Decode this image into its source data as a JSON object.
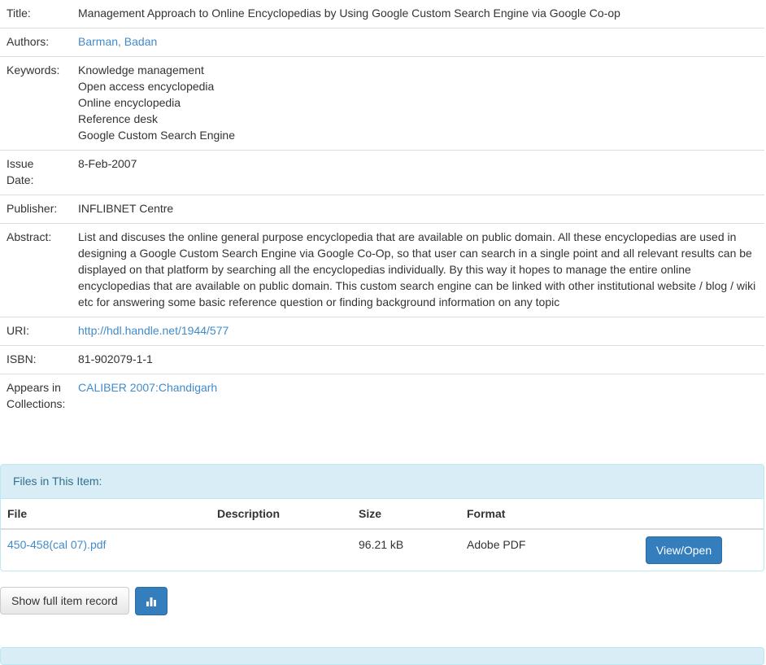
{
  "item": {
    "title_label": "Title:",
    "title": "Management Approach to Online Encyclopedias by Using Google Custom Search Engine via Google Co-op",
    "authors_label": "Authors:",
    "author": "Barman, Badan",
    "keywords_label": "Keywords:",
    "keywords": [
      "Knowledge management",
      "Open access encyclopedia",
      "Online encyclopedia",
      "Reference desk",
      "Google Custom Search Engine"
    ],
    "issue_date_label_1": "Issue",
    "issue_date_label_2": "Date:",
    "issue_date": "8-Feb-2007",
    "publisher_label": "Publisher:",
    "publisher": "INFLIBNET Centre",
    "abstract_label": "Abstract:",
    "abstract": "List and discuses the online general purpose encyclopedia that are available on public domain. All these encyclopedias are used in designing a Google Custom Search Engine via Google Co-Op, so that user can search in a single point and all relevant results can be displayed on that platform by searching all the encyclopedias individually. By this way it hopes to manage the entire online encyclopedias that are available on public domain. This custom search engine can be linked with other institutional website / blog / wiki etc for answering some basic reference question or finding background information on any topic",
    "uri_label": "URI:",
    "uri": "http://hdl.handle.net/1944/577",
    "isbn_label": "ISBN:",
    "isbn": "81-902079-1-1",
    "collections_label_1": "Appears in",
    "collections_label_2": "Collections:",
    "collection": "CALIBER 2007:Chandigarh"
  },
  "files": {
    "heading": "Files in This Item:",
    "columns": [
      "File",
      "Description",
      "Size",
      "Format"
    ],
    "rows": [
      {
        "file": "450-458(cal 07).pdf",
        "description": "",
        "size": "96.21 kB",
        "format": "Adobe PDF",
        "action": "View/Open"
      }
    ]
  },
  "actions": {
    "show_full_record": "Show full item record",
    "stats_icon": "bar-chart-icon"
  },
  "colors": {
    "link": "#428bca",
    "primary_button": "#357ebd",
    "panel_heading_bg": "#d9edf7",
    "panel_heading_text": "#31708f"
  }
}
